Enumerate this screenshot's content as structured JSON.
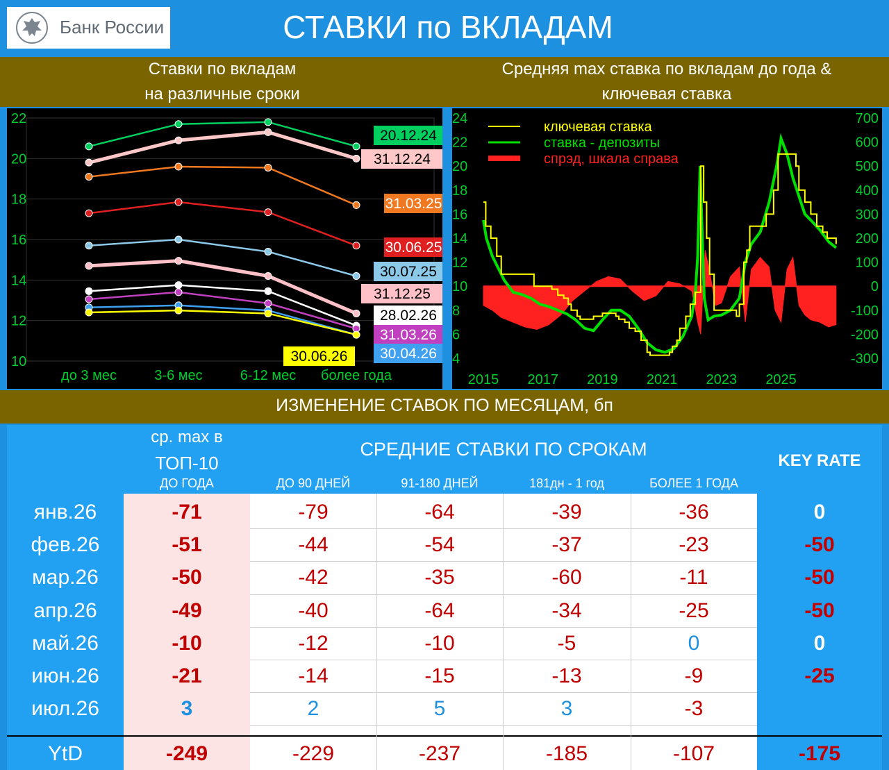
{
  "header": {
    "logo_text": "Банк России",
    "title": "СТАВКИ по ВКЛАДАМ"
  },
  "left_panel": {
    "title_line1": "Ставки по вкладам",
    "title_line2": "на различные сроки"
  },
  "right_panel": {
    "title_line1": "Средняя max ставка по вкладам до года &",
    "title_line2": "ключевая ставка"
  },
  "chart_data": [
    {
      "type": "line",
      "title": "Ставки по вкладам на различные сроки",
      "categories": [
        "до 3 мес",
        "3-6 мес",
        "6-12 мес",
        "более года"
      ],
      "ylim": [
        10,
        22
      ],
      "yticks": [
        10,
        12,
        14,
        16,
        18,
        20,
        22
      ],
      "series": [
        {
          "name": "20.12.24",
          "color": "#00d060",
          "values": [
            20.6,
            21.7,
            21.8,
            20.6
          ]
        },
        {
          "name": "31.12.24",
          "color": "#ffc8c8",
          "values": [
            19.8,
            20.9,
            21.3,
            20.0
          ]
        },
        {
          "name": "31.03.25",
          "color": "#f07820",
          "values": [
            19.1,
            19.6,
            19.55,
            17.7
          ]
        },
        {
          "name": "30.06.25",
          "color": "#e02020",
          "values": [
            17.3,
            17.85,
            17.35,
            15.7
          ]
        },
        {
          "name": "30.07.25",
          "color": "#8cc8e8",
          "values": [
            15.7,
            16.0,
            15.4,
            14.2
          ]
        },
        {
          "name": "31.12.25",
          "color": "#ffc0c8",
          "values": [
            14.7,
            14.95,
            14.2,
            12.35
          ]
        },
        {
          "name": "28.02.26",
          "color": "#ffffff",
          "values": [
            13.45,
            13.75,
            13.45,
            11.75
          ]
        },
        {
          "name": "31.03.26",
          "color": "#c040c0",
          "values": [
            13.05,
            13.4,
            12.85,
            11.6
          ]
        },
        {
          "name": "30.04.26",
          "color": "#40a0f0",
          "values": [
            12.65,
            12.75,
            12.5,
            11.3
          ]
        },
        {
          "name": "30.06.26",
          "color": "#ffff00",
          "values": [
            12.4,
            12.5,
            12.35,
            11.3
          ]
        }
      ]
    },
    {
      "type": "line",
      "title": "Средняя max ставка по вкладам до года & ключевая ставка",
      "x_range": [
        2015,
        2026.9
      ],
      "xticks": [
        2015,
        2017,
        2019,
        2021,
        2023,
        2025
      ],
      "ylim": [
        4,
        24
      ],
      "yticks": [
        4,
        6,
        8,
        10,
        12,
        14,
        16,
        18,
        20,
        22,
        24
      ],
      "y2lim": [
        -300,
        700
      ],
      "y2ticks": [
        -300,
        -200,
        -100,
        0,
        100,
        200,
        300,
        400,
        500,
        600,
        700
      ],
      "legend": [
        "ключевая ставка",
        "ставка - депозиты",
        "спрэд, шкала справа"
      ],
      "series": [
        {
          "name": "ключевая ставка",
          "color": "#ffff00",
          "x": [
            2015.0,
            2015.08,
            2015.25,
            2015.45,
            2015.6,
            2016.45,
            2016.7,
            2017.3,
            2017.5,
            2017.7,
            2017.85,
            2017.95,
            2018.15,
            2018.25,
            2018.7,
            2019.0,
            2019.45,
            2019.55,
            2019.75,
            2019.9,
            2020.1,
            2020.3,
            2020.5,
            2020.6,
            2021.25,
            2021.35,
            2021.5,
            2021.6,
            2021.8,
            2021.95,
            2022.12,
            2022.3,
            2022.4,
            2022.5,
            2022.6,
            2022.75,
            2023.5,
            2023.6,
            2023.75,
            2023.85,
            2023.95,
            2024.5,
            2024.75,
            2024.9,
            2025.4,
            2025.5,
            2025.6,
            2025.8,
            2026.0,
            2026.2,
            2026.4,
            2026.55,
            2026.85
          ],
          "y": [
            17,
            15,
            14,
            12.5,
            11,
            11,
            10,
            9.75,
            9.25,
            9,
            8.5,
            8,
            7.5,
            7.25,
            7.5,
            7.75,
            7.5,
            7.25,
            7,
            6.5,
            6.25,
            5.5,
            4.5,
            4.25,
            4.5,
            5,
            5.5,
            6.5,
            7.5,
            8.5,
            9.5,
            20,
            17,
            14,
            11,
            8,
            7.5,
            8.5,
            12,
            13,
            15,
            16,
            18,
            21,
            21,
            20,
            18,
            17,
            16,
            15,
            14.5,
            14,
            13.5
          ]
        },
        {
          "name": "ставка - депозиты",
          "color": "#00e000",
          "x": [
            2015.0,
            2015.1,
            2015.3,
            2015.5,
            2015.7,
            2016.0,
            2016.3,
            2016.6,
            2016.9,
            2017.2,
            2017.5,
            2017.8,
            2018.1,
            2018.4,
            2018.7,
            2019.0,
            2019.3,
            2019.6,
            2019.9,
            2020.2,
            2020.5,
            2020.8,
            2021.1,
            2021.4,
            2021.7,
            2022.0,
            2022.12,
            2022.2,
            2022.28,
            2022.33,
            2022.42,
            2022.55,
            2022.75,
            2023.0,
            2023.3,
            2023.6,
            2023.8,
            2024.0,
            2024.3,
            2024.6,
            2024.85,
            2025.0,
            2025.2,
            2025.4,
            2025.6,
            2025.8,
            2026.0,
            2026.3,
            2026.6,
            2026.85
          ],
          "y": [
            15.5,
            14,
            12.5,
            11.5,
            10.5,
            9.5,
            9.3,
            9,
            8.5,
            8.3,
            8,
            7.7,
            7.2,
            6.5,
            6.3,
            7.2,
            8,
            8,
            7.5,
            6.5,
            5.3,
            4.7,
            4.5,
            4.8,
            5.8,
            7.5,
            9.5,
            12.5,
            20,
            16,
            9,
            7.2,
            7.5,
            7.6,
            8,
            9,
            12,
            13.5,
            14.5,
            17,
            20,
            22.3,
            21,
            19,
            17.5,
            16,
            15.5,
            14.7,
            13.7,
            13.2
          ]
        },
        {
          "name": "спрэд, шкала справа",
          "color": "#ff2020",
          "type": "area",
          "x": [
            2015.0,
            2015.3,
            2015.6,
            2016.0,
            2016.4,
            2016.8,
            2017.2,
            2017.6,
            2018.0,
            2018.4,
            2018.8,
            2019.2,
            2019.6,
            2020.0,
            2020.4,
            2020.8,
            2021.2,
            2021.6,
            2022.0,
            2022.1,
            2022.2,
            2022.3,
            2022.45,
            2022.6,
            2022.8,
            2023.0,
            2023.3,
            2023.6,
            2023.8,
            2024.0,
            2024.3,
            2024.6,
            2024.8,
            2025.0,
            2025.2,
            2025.4,
            2025.6,
            2025.8,
            2026.0,
            2026.3,
            2026.6,
            2026.85
          ],
          "y": [
            -80,
            -100,
            -130,
            -150,
            -170,
            -180,
            -160,
            -120,
            -60,
            -20,
            20,
            40,
            30,
            -20,
            -60,
            -40,
            20,
            10,
            -20,
            -80,
            -150,
            -200,
            150,
            60,
            -80,
            -70,
            40,
            80,
            -150,
            70,
            120,
            80,
            -100,
            -150,
            70,
            120,
            -80,
            -120,
            -140,
            -150,
            -170,
            -160
          ]
        }
      ]
    }
  ],
  "table": {
    "band_title": "ИЗМЕНЕНИЕ СТАВОК ПО МЕСЯЦАМ, бп",
    "col1_header_line1": "ср. max в",
    "col1_header_line2": "ТОП-10",
    "col1_header_line3": "ДО ГОДА",
    "group_header": "СРЕДНИЕ СТАВКИ ПО СРОКАМ",
    "subheaders": [
      "ДО 90 ДНЕЙ",
      "91-180 ДНЕЙ",
      "181дн - 1 год",
      "БОЛЕЕ 1 ГОДА"
    ],
    "key_rate_header": "KEY RATE",
    "rows": [
      {
        "label": "янв.26",
        "top10": "-71",
        "d90": "-79",
        "d180": "-64",
        "d365": "-39",
        "over1": "-36",
        "key": "0"
      },
      {
        "label": "фев.26",
        "top10": "-51",
        "d90": "-44",
        "d180": "-54",
        "d365": "-37",
        "over1": "-23",
        "key": "-50"
      },
      {
        "label": "мар.26",
        "top10": "-50",
        "d90": "-42",
        "d180": "-35",
        "d365": "-60",
        "over1": "-11",
        "key": "-50"
      },
      {
        "label": "апр.26",
        "top10": "-49",
        "d90": "-40",
        "d180": "-64",
        "d365": "-34",
        "over1": "-25",
        "key": "-50"
      },
      {
        "label": "май.26",
        "top10": "-10",
        "d90": "-12",
        "d180": "-10",
        "d365": "-5",
        "over1": "0",
        "key": "0"
      },
      {
        "label": "июн.26",
        "top10": "-21",
        "d90": "-14",
        "d180": "-15",
        "d365": "-13",
        "over1": "-9",
        "key": "-25"
      },
      {
        "label": "июл.26",
        "top10": "3",
        "d90": "2",
        "d180": "5",
        "d365": "3",
        "over1": "-3",
        "key": ""
      }
    ],
    "ytd": {
      "label": "YtD",
      "top10": "-249",
      "d90": "-229",
      "d180": "-237",
      "d365": "-185",
      "over1": "-107",
      "key": "-175"
    }
  }
}
